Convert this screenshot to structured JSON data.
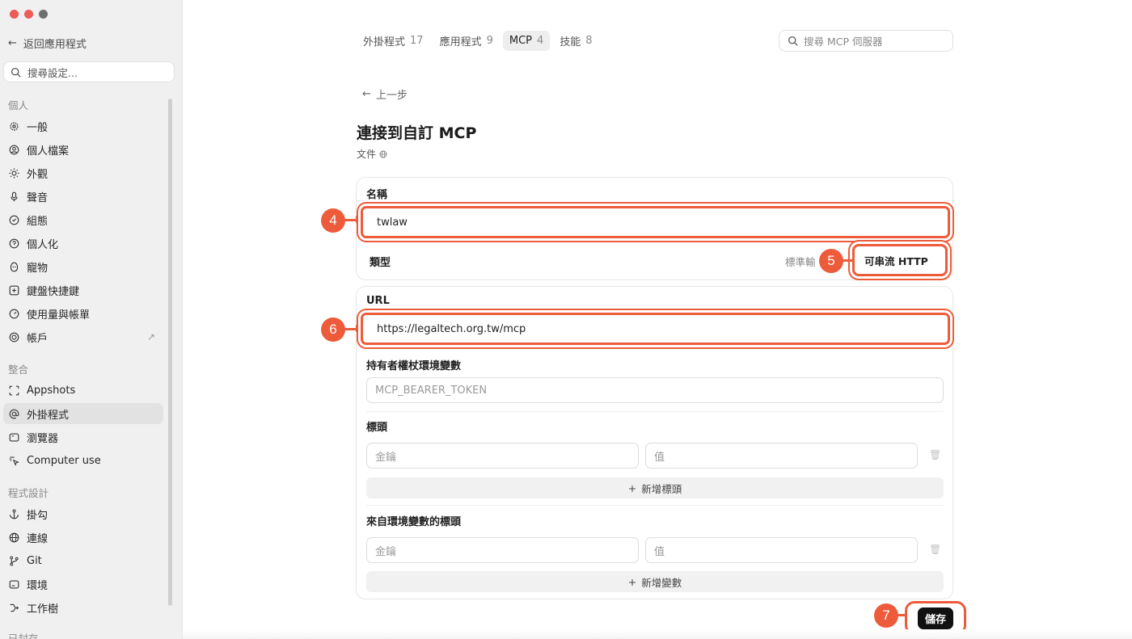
{
  "sidebar": {
    "back_label": "返回應用程式",
    "search_placeholder": "搜尋設定...",
    "sections": {
      "personal": "個人",
      "integration": "整合",
      "programming": "程式設計",
      "archived": "已封存"
    },
    "personal_items": [
      {
        "label": "一般",
        "icon": "gear-icon"
      },
      {
        "label": "個人檔案",
        "icon": "profile-icon"
      },
      {
        "label": "外觀",
        "icon": "sun-icon"
      },
      {
        "label": "聲音",
        "icon": "microphone-icon"
      },
      {
        "label": "組態",
        "icon": "config-icon"
      },
      {
        "label": "個人化",
        "icon": "personalize-icon"
      },
      {
        "label": "寵物",
        "icon": "pet-icon"
      },
      {
        "label": "鍵盤快捷鍵",
        "icon": "keyboard-icon"
      },
      {
        "label": "使用量與帳單",
        "icon": "gauge-icon"
      },
      {
        "label": "帳戶",
        "icon": "account-icon"
      }
    ],
    "integration_items": [
      {
        "label": "Appshots",
        "icon": "capture-icon"
      },
      {
        "label": "外掛程式",
        "icon": "at-icon"
      },
      {
        "label": "瀏覽器",
        "icon": "browser-icon"
      },
      {
        "label": "Computer use",
        "icon": "cursor-click-icon"
      }
    ],
    "programming_items": [
      {
        "label": "掛勾",
        "icon": "anchor-icon"
      },
      {
        "label": "連線",
        "icon": "globe-icon"
      },
      {
        "label": "Git",
        "icon": "git-branch-icon"
      },
      {
        "label": "環境",
        "icon": "terminal-icon"
      },
      {
        "label": "工作樹",
        "icon": "tree-icon"
      }
    ]
  },
  "tabs": [
    {
      "label": "外掛程式",
      "count": "17"
    },
    {
      "label": "應用程式",
      "count": "9"
    },
    {
      "label": "MCP",
      "count": "4"
    },
    {
      "label": "技能",
      "count": "8"
    }
  ],
  "main": {
    "search_placeholder": "搜尋 MCP 伺服器",
    "back_step": "上一步",
    "title": "連接到自訂 MCP",
    "doc_link": "文件",
    "name_label": "名稱",
    "name_value": "twlaw",
    "type_label": "類型",
    "type_option_inactive": "標準輸",
    "type_option_active": "可串流 HTTP",
    "url_label": "URL",
    "url_value": "https://legaltech.org.tw/mcp",
    "bearer_label": "持有者權杖環境變數",
    "bearer_placeholder": "MCP_BEARER_TOKEN",
    "headers_label": "標頭",
    "key_placeholder": "金鑰",
    "value_placeholder": "值",
    "add_header": "新增標頭",
    "env_headers_label": "來自環境變數的標頭",
    "add_variable": "新增變數",
    "save_label": "儲存"
  },
  "markers": {
    "m4": "4",
    "m5": "5",
    "m6": "6",
    "m7": "7"
  },
  "colors": {
    "highlight": "#ee5b3a",
    "save_button": "#111111",
    "sidebar_bg": "#f0f0f0"
  }
}
